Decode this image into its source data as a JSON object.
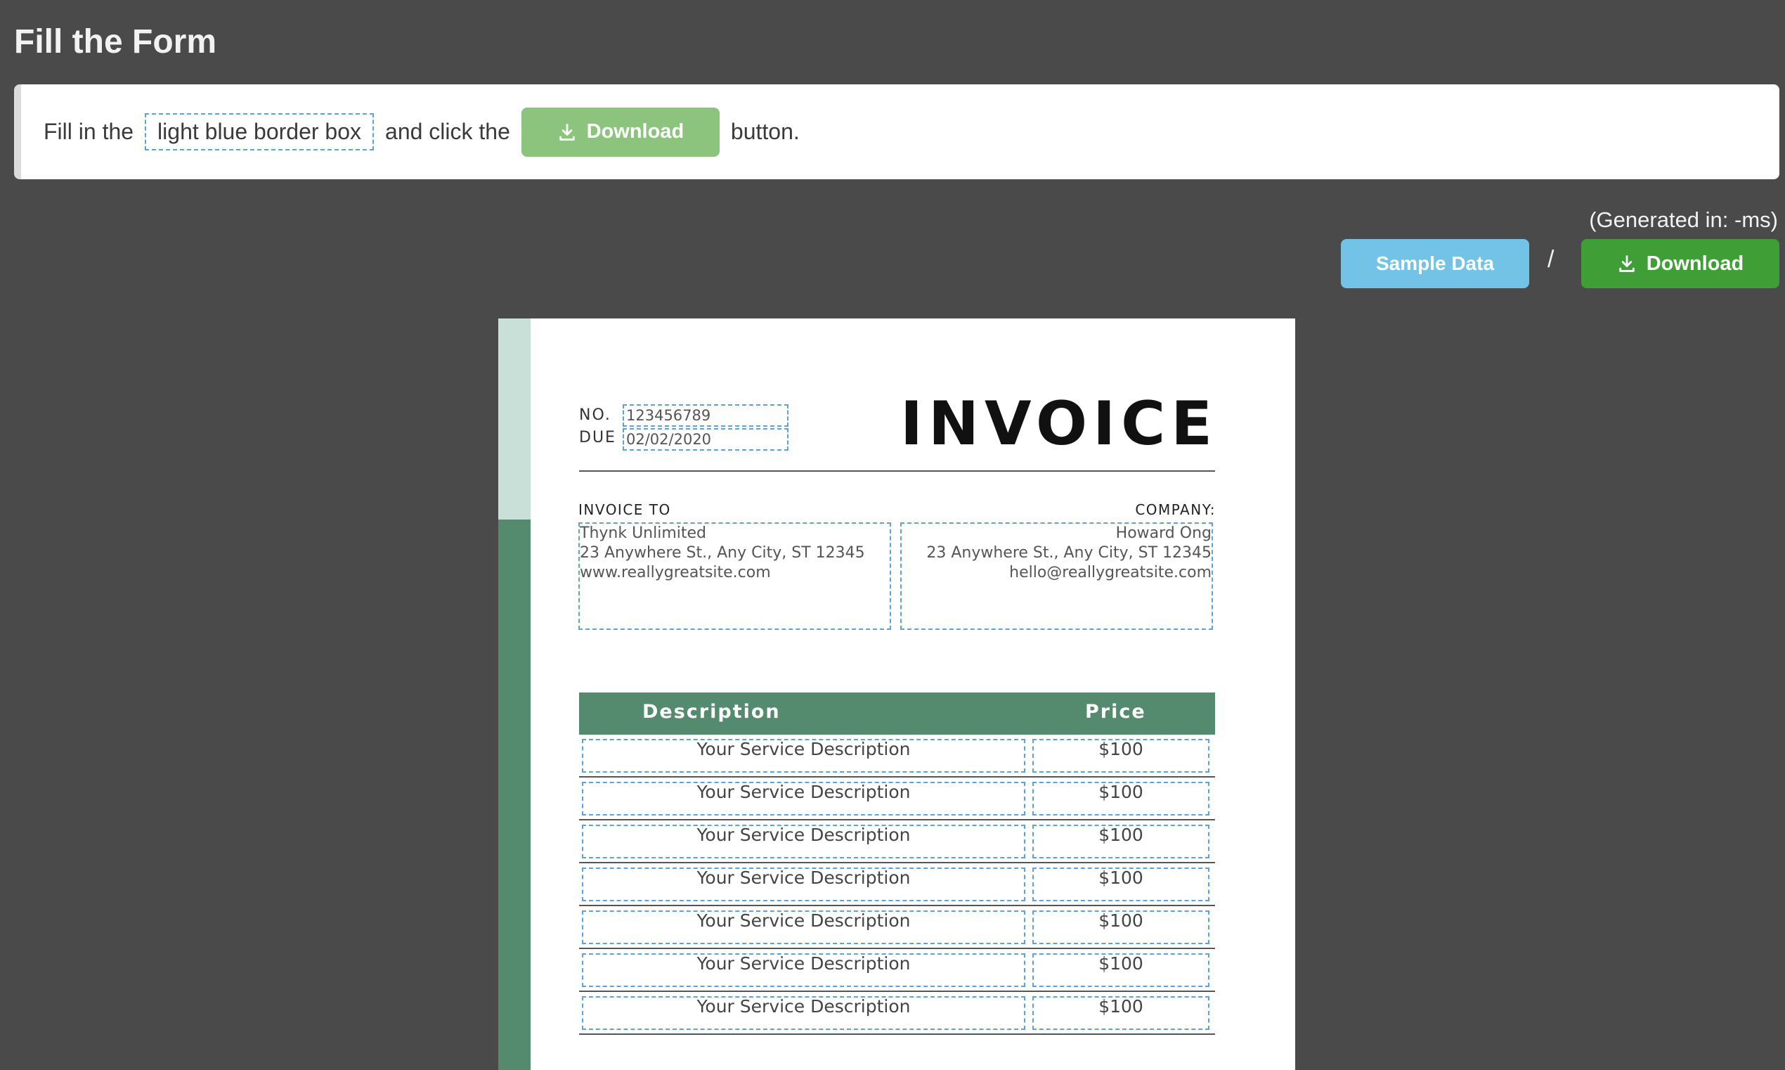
{
  "page": {
    "title": "Fill the Form"
  },
  "instruction": {
    "prefix": "Fill in the",
    "box_text": "light blue border box",
    "middle": "and click the",
    "button_label": "Download",
    "suffix": "button."
  },
  "toolbar": {
    "generated_text": "(Generated in: -ms)",
    "sample_label": "Sample Data",
    "separator": "/",
    "download_label": "Download"
  },
  "invoice": {
    "title": "INVOICE",
    "no_label": "NO.",
    "no_value": "123456789",
    "due_label": "DUE",
    "due_value": "02/02/2020",
    "invoice_to": {
      "label": "INVOICE TO",
      "lines": [
        "Thynk Unlimited",
        "23 Anywhere St., Any City, ST 12345",
        "www.reallygreatsite.com"
      ]
    },
    "company": {
      "label": "COMPANY:",
      "lines": [
        "Howard Ong",
        "23 Anywhere St., Any City, ST 12345",
        "hello@reallygreatsite.com"
      ]
    },
    "table": {
      "headers": {
        "description": "Description",
        "price": "Price"
      },
      "rows": [
        {
          "description": "Your Service Description",
          "price": "$100"
        },
        {
          "description": "Your Service Description",
          "price": "$100"
        },
        {
          "description": "Your Service Description",
          "price": "$100"
        },
        {
          "description": "Your Service Description",
          "price": "$100"
        },
        {
          "description": "Your Service Description",
          "price": "$100"
        },
        {
          "description": "Your Service Description",
          "price": "$100"
        },
        {
          "description": "Your Service Description",
          "price": "$100"
        }
      ]
    }
  },
  "colors": {
    "background": "#4a4a4a",
    "accent_green": "#548a6e",
    "sample_blue": "#72c3e6",
    "download_green": "#3f9e35",
    "field_border": "#5aa3e0"
  },
  "icons": {
    "download": "download-icon"
  }
}
